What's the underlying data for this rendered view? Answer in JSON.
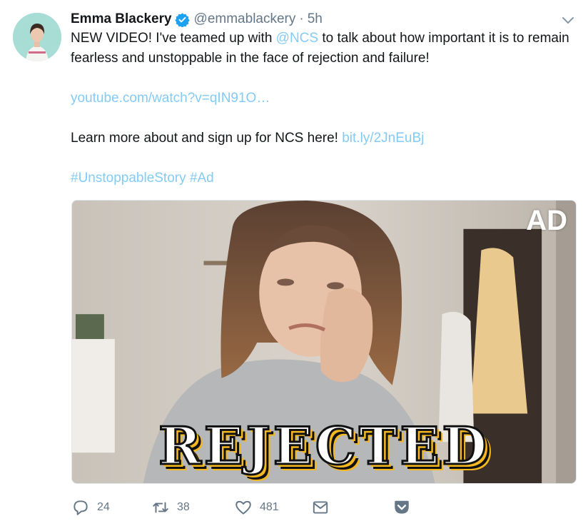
{
  "tweet": {
    "display_name": "Emma Blackery",
    "handle": "@emmablackery",
    "separator": "·",
    "time": "5h",
    "text": {
      "line1_before": "NEW VIDEO! I've teamed up with ",
      "mention": "@NCS",
      "line1_after": " to talk about how important it is to remain fearless and unstoppable in the face of rejection and failure!",
      "youtube_link": "youtube.com/watch?v=qIN91O…",
      "learn_more": "Learn more about and sign up for NCS here! ",
      "short_link": "bit.ly/2JnEuBj",
      "hashtags": "#UnstoppableStory #Ad"
    },
    "media": {
      "badge": "AD",
      "overlay_title": "REJECTED"
    },
    "actions": {
      "replies": "24",
      "retweets": "38",
      "likes": "481"
    }
  },
  "colors": {
    "link": "#1da1f2",
    "verified": "#1da1f2",
    "muted": "#657786",
    "overlay_accent": "#f5b820"
  },
  "icons": [
    "verified-badge-icon",
    "chevron-down-icon",
    "reply-icon",
    "retweet-icon",
    "like-icon",
    "direct-message-icon",
    "pocket-icon"
  ]
}
